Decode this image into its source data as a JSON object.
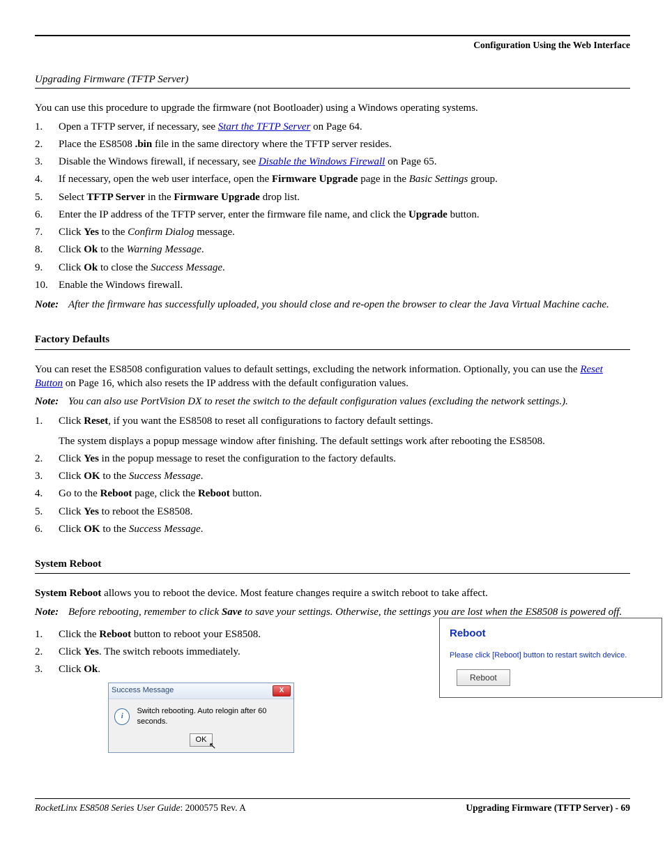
{
  "header": {
    "right": "Configuration Using the Web Interface"
  },
  "s1": {
    "title": "Upgrading Firmware (TFTP Server)",
    "intro": "You can use this procedure to upgrade the firmware (not Bootloader) using a Windows operating systems.",
    "li1_a": "Open a TFTP server, if necessary, see ",
    "li1_link": "Start the TFTP Server",
    "li1_b": " on Page 64.",
    "li2_a": "Place the ES8508 ",
    "li2_bold": ".bin",
    "li2_b": " file in the same directory where the TFTP server resides.",
    "li3_a": "Disable the Windows firewall, if necessary, see ",
    "li3_link": "Disable the Windows Firewall",
    "li3_b": " on Page 65.",
    "li4_a": "If necessary, open the web user interface, open the ",
    "li4_b1": "Firmware Upgrade",
    "li4_b": " page in the ",
    "li4_i": "Basic Settings",
    "li4_c": " group.",
    "li5_a": "Select ",
    "li5_b1": "TFTP Server",
    "li5_b": " in the ",
    "li5_b2": "Firmware Upgrade",
    "li5_c": " drop list.",
    "li6_a": "Enter the IP address of the TFTP server, enter the firmware file name, and click the ",
    "li6_b1": "Upgrade",
    "li6_b": " button.",
    "li7_a": "Click ",
    "li7_b1": "Yes",
    "li7_b": " to the ",
    "li7_i": "Confirm Dialog",
    "li7_c": " message.",
    "li8_a": "Click ",
    "li8_b1": "Ok",
    "li8_b": " to the ",
    "li8_i": "Warning Message",
    "li8_c": ".",
    "li9_a": "Click ",
    "li9_b1": "Ok",
    "li9_b": " to close the ",
    "li9_i": "Success Message",
    "li9_c": ".",
    "li10": "Enable the Windows firewall.",
    "note": "After the firmware has successfully uploaded, you should close and re-open the browser to clear the Java Virtual Machine cache."
  },
  "s2": {
    "heading": "Factory Defaults",
    "p1_a": "You can reset the ES8508 configuration values to default settings, excluding the network information. Optionally, you can use the ",
    "p1_link": "Reset Button",
    "p1_b": " on Page 16, which also resets the IP address with the default configuration values.",
    "note": "You can also use PortVision DX to reset the switch to the default configuration values (excluding the network settings.).",
    "li1_a": "Click ",
    "li1_b1": "Reset",
    "li1_b": ", if you want the ES8508 to reset all configurations to factory default settings.",
    "li1_sub": "The system displays a popup message window after finishing. The default settings work after rebooting the ES8508.",
    "li2_a": "Click ",
    "li2_b1": "Yes",
    "li2_b": " in the popup message to reset the configuration to the factory defaults.",
    "li3_a": "Click ",
    "li3_b1": "OK",
    "li3_b": " to the ",
    "li3_i": "Success Message",
    "li3_c": ".",
    "li4_a": "Go to the ",
    "li4_b1": "Reboot",
    "li4_b": " page, click the ",
    "li4_b2": "Reboot",
    "li4_c": " button.",
    "li5_a": "Click ",
    "li5_b1": "Yes",
    "li5_b": " to reboot the ES8508.",
    "li6_a": "Click ",
    "li6_b1": "OK",
    "li6_b": " to the ",
    "li6_i": "Success Message",
    "li6_c": "."
  },
  "s3": {
    "heading": "System Reboot",
    "p1_b": "System Reboot",
    "p1": " allows you to reboot the device. Most feature changes require a switch reboot to take affect.",
    "note_a": "Before rebooting, remember to click ",
    "note_b": "Save",
    "note_c": " to save your settings. Otherwise, the settings you are lost when the ES8508 is powered off.",
    "li1_a": "Click the ",
    "li1_b1": "Reboot",
    "li1_b": " button to reboot your ES8508.",
    "li2_a": "Click ",
    "li2_b1": "Yes",
    "li2_b": ". The switch reboots immediately.",
    "li3_a": "Click ",
    "li3_b1": "Ok",
    "li3_b": "."
  },
  "dialog": {
    "title": "Success Message",
    "close": "X",
    "message": "Switch rebooting. Auto relogin after 60 seconds.",
    "ok": "OK"
  },
  "panel": {
    "title": "Reboot",
    "msg": "Please click [Reboot] button to restart switch device.",
    "btn": "Reboot"
  },
  "footer": {
    "left_i": "RocketLinx ES8508 Series  User Guide",
    "left_b": ": 2000575 Rev. A",
    "right": "Upgrading Firmware (TFTP Server) - 69"
  },
  "note_label": "Note:"
}
